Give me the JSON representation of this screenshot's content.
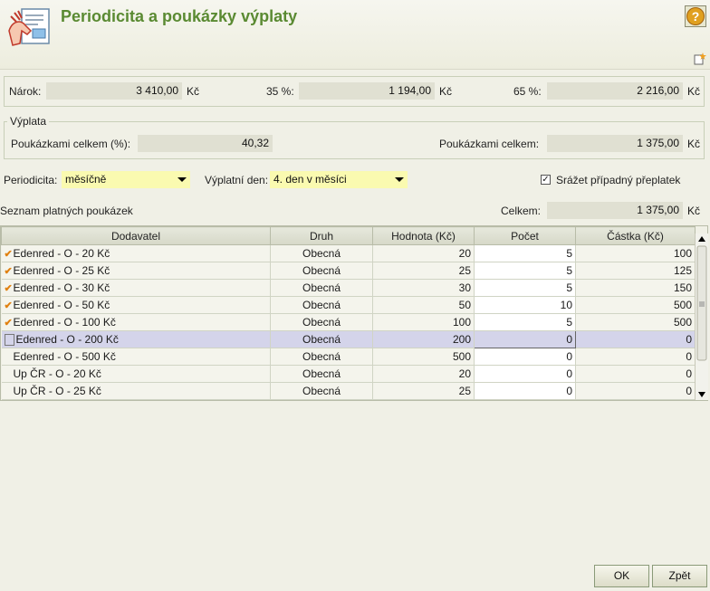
{
  "header": {
    "title": "Periodicita a poukázky výplaty"
  },
  "narok": {
    "label": "Nárok:",
    "value": "3 410,00",
    "currency": "Kč",
    "p35_label": "35 %:",
    "p35_value": "1 194,00",
    "p35_currency": "Kč",
    "p65_label": "65 %:",
    "p65_value": "2 216,00",
    "p65_currency": "Kč"
  },
  "vyplata": {
    "legend": "Výplata",
    "pct_label": "Poukázkami celkem (%):",
    "pct_value": "40,32",
    "total_label": "Poukázkami celkem:",
    "total_value": "1 375,00",
    "total_currency": "Kč"
  },
  "options": {
    "periodicita_label": "Periodicita:",
    "periodicita_value": "měsíčně",
    "den_label": "Výplatní den:",
    "den_value": "4. den v měsíci",
    "srazet_label": "Srážet případný přeplatek",
    "srazet_checked": "✓"
  },
  "list": {
    "title": "Seznam platných poukázek",
    "celkem_label": "Celkem:",
    "celkem_value": "1 375,00",
    "celkem_currency": "Kč"
  },
  "table": {
    "headers": [
      "Dodavatel",
      "Druh",
      "Hodnota (Kč)",
      "Počet",
      "Částka (Kč)"
    ],
    "rows": [
      {
        "mark": "✔",
        "dodavatel": "Edenred - O - 20 Kč",
        "druh": "Obecná",
        "hodnota": "20",
        "pocet": "5",
        "castka": "100"
      },
      {
        "mark": "✔",
        "dodavatel": "Edenred - O - 25 Kč",
        "druh": "Obecná",
        "hodnota": "25",
        "pocet": "5",
        "castka": "125"
      },
      {
        "mark": "✔",
        "dodavatel": "Edenred - O - 30 Kč",
        "druh": "Obecná",
        "hodnota": "30",
        "pocet": "5",
        "castka": "150"
      },
      {
        "mark": "✔",
        "dodavatel": "Edenred - O - 50 Kč",
        "druh": "Obecná",
        "hodnota": "50",
        "pocet": "10",
        "castka": "500"
      },
      {
        "mark": "✔",
        "dodavatel": "Edenred - O - 100 Kč",
        "druh": "Obecná",
        "hodnota": "100",
        "pocet": "5",
        "castka": "500"
      },
      {
        "mark": "",
        "dodavatel": "Edenred - O - 200 Kč",
        "druh": "Obecná",
        "hodnota": "200",
        "pocet": "0",
        "castka": "0"
      },
      {
        "mark": "",
        "dodavatel": "Edenred - O - 500 Kč",
        "druh": "Obecná",
        "hodnota": "500",
        "pocet": "0",
        "castka": "0"
      },
      {
        "mark": "",
        "dodavatel": "Up ČR - O - 20 Kč",
        "druh": "Obecná",
        "hodnota": "20",
        "pocet": "0",
        "castka": "0"
      },
      {
        "mark": "",
        "dodavatel": "Up ČR - O - 25 Kč",
        "druh": "Obecná",
        "hodnota": "25",
        "pocet": "0",
        "castka": "0"
      }
    ]
  },
  "buttons": {
    "ok": "OK",
    "back": "Zpět"
  },
  "icons": {
    "logo": "hands-document-icon",
    "help": "help-icon",
    "new": "new-document-icon"
  }
}
